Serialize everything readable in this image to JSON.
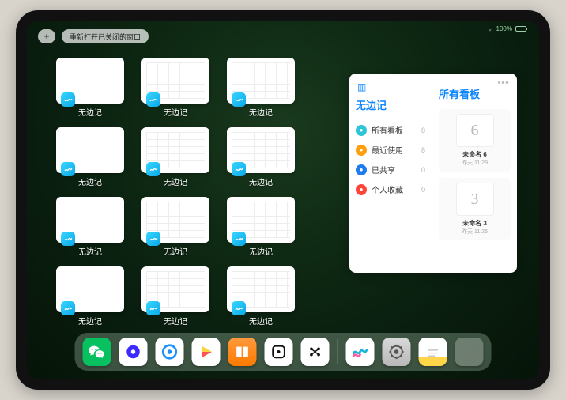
{
  "status": {
    "battery_text": "100%"
  },
  "topbar": {
    "plus_label": "+",
    "reopen_label": "重新打开已关闭的窗口"
  },
  "app_name": "无边记",
  "windows": [
    {
      "label": "无边记",
      "variant": "blank"
    },
    {
      "label": "无边记",
      "variant": "calendar"
    },
    {
      "label": "无边记",
      "variant": "calendar"
    },
    {
      "label": "无边记",
      "variant": "blank"
    },
    {
      "label": "无边记",
      "variant": "calendar"
    },
    {
      "label": "无边记",
      "variant": "calendar"
    },
    {
      "label": "无边记",
      "variant": "blank"
    },
    {
      "label": "无边记",
      "variant": "calendar"
    },
    {
      "label": "无边记",
      "variant": "calendar"
    },
    {
      "label": "无边记",
      "variant": "blank"
    },
    {
      "label": "无边记",
      "variant": "calendar"
    },
    {
      "label": "无边记",
      "variant": "calendar"
    }
  ],
  "panel": {
    "left_title": "无边记",
    "items": [
      {
        "icon": "cyan",
        "label": "所有看板",
        "count": 8
      },
      {
        "icon": "orange",
        "label": "最近使用",
        "count": 8
      },
      {
        "icon": "blue",
        "label": "已共享",
        "count": 0
      },
      {
        "icon": "red",
        "label": "个人收藏",
        "count": 0
      }
    ],
    "right_title": "所有看板",
    "boards": [
      {
        "glyph": "6",
        "name": "未命名 6",
        "sub": "昨天 11:29"
      },
      {
        "glyph": "3",
        "name": "未命名 3",
        "sub": "昨天 11:26"
      }
    ]
  },
  "dock": {
    "apps": [
      {
        "name": "wechat",
        "label": "微信"
      },
      {
        "name": "quark",
        "label": "夸克"
      },
      {
        "name": "qqbrowser",
        "label": "QQ浏览器"
      },
      {
        "name": "play",
        "label": "爱奇艺"
      },
      {
        "name": "books",
        "label": "图书"
      },
      {
        "name": "dice",
        "label": "游戏"
      },
      {
        "name": "dots",
        "label": "应用"
      }
    ],
    "recent": [
      {
        "name": "freeform",
        "label": "无边记"
      },
      {
        "name": "settings",
        "label": "设置"
      },
      {
        "name": "notes",
        "label": "备忘录"
      },
      {
        "name": "applib",
        "label": "App资源库"
      }
    ]
  }
}
